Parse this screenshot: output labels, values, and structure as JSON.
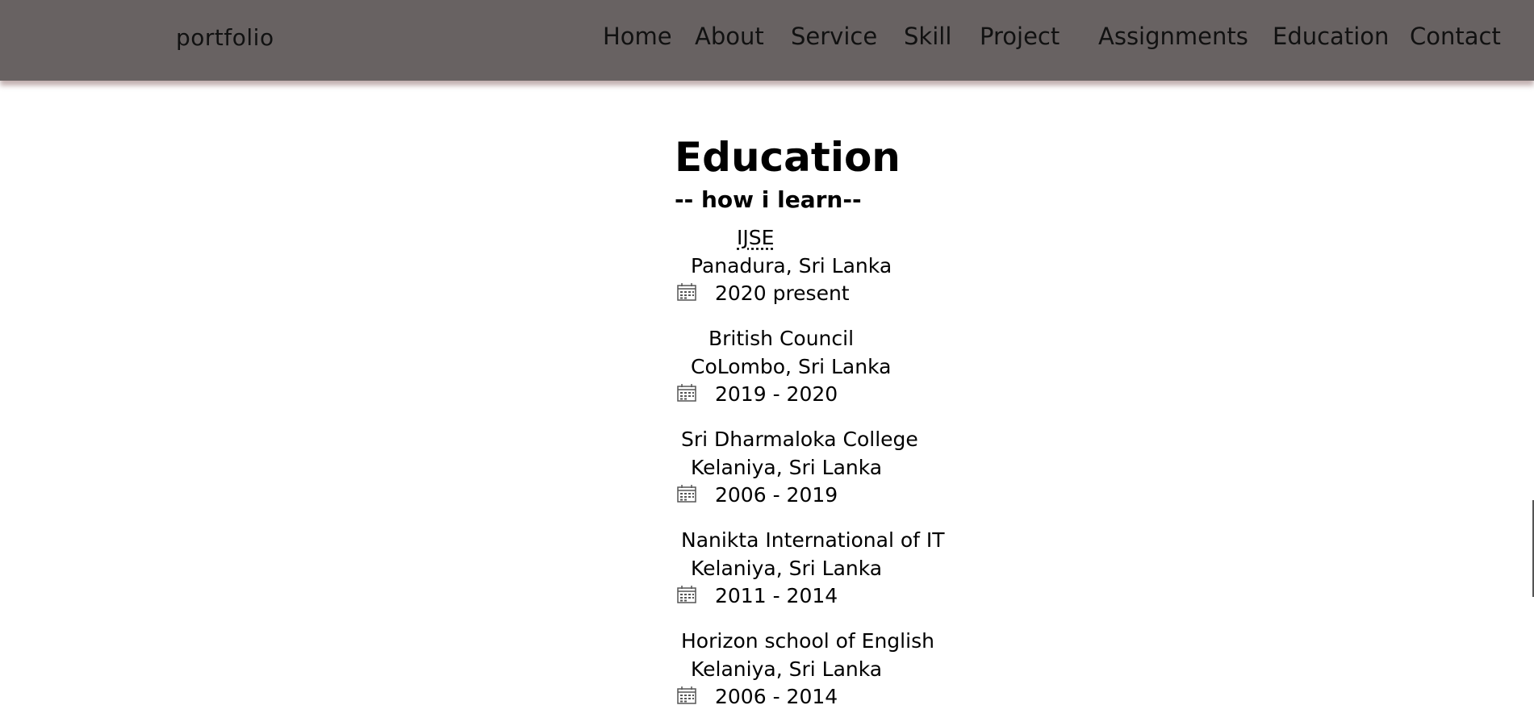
{
  "navbar": {
    "brand": "portfolio",
    "items": [
      "Home",
      "About",
      "Service",
      "Skill",
      "Project",
      "Assignments",
      "Education",
      "Contact"
    ]
  },
  "education": {
    "title": "Education",
    "subtitle": "-- how i learn--",
    "entries": [
      {
        "school": "IJSE",
        "location": "Panadura, Sri Lanka",
        "years": "2020 present"
      },
      {
        "school": "British Council",
        "location": "CoLombo, Sri Lanka",
        "years": "2019 - 2020"
      },
      {
        "school": "Sri Dharmaloka College",
        "location": "Kelaniya, Sri Lanka",
        "years": "2006 - 2019"
      },
      {
        "school": "Nanikta International of IT",
        "location": "Kelaniya, Sri Lanka",
        "years": "2011 - 2014"
      },
      {
        "school": "Horizon school of English",
        "location": "Kelaniya, Sri Lanka",
        "years": "2006 - 2014"
      }
    ]
  },
  "icons": {
    "date": "calendar-icon"
  },
  "colors": {
    "navbar_bg": "#686262",
    "text": "#000000",
    "page_bg": "#ffffff"
  }
}
